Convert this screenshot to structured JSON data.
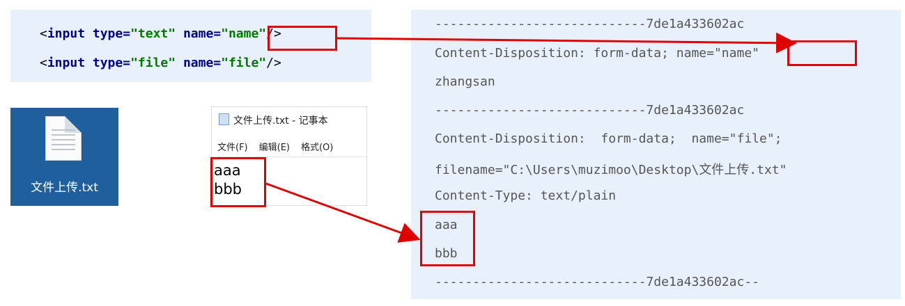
{
  "html_code": {
    "line1": {
      "open": "<",
      "tag": "input",
      "type_attr": "type=",
      "type_val": "\"text\"",
      "name_attr": "name=",
      "name_val": "\"name\"",
      "close": "/>"
    },
    "line2": {
      "open": "<",
      "tag": "input",
      "type_attr": "type=",
      "type_val": "\"file\"",
      "name_attr": "name=",
      "name_val": "\"file\"",
      "close": "/>"
    }
  },
  "desktop_file": {
    "label": "文件上传.txt",
    "icon": "text-file-icon"
  },
  "notepad": {
    "title": "文件上传.txt - 记事本",
    "menu": [
      "文件(F)",
      "编辑(E)",
      "格式(O)"
    ],
    "content": [
      "aaa",
      "bbb"
    ]
  },
  "request_body": [
    "----------------------------7de1a433602ac",
    "Content-Disposition: form-data; name=\"name\"",
    "zhangsan",
    "----------------------------7de1a433602ac",
    "Content-Disposition:  form-data;  name=\"file\";",
    "filename=\"C:\\Users\\muzimoo\\Desktop\\文件上传.txt\"",
    "Content-Type: text/plain",
    "aaa",
    "bbb",
    "----------------------------7de1a433602ac--"
  ],
  "colors": {
    "highlight": "#e00000",
    "panel_bg": "#e8f1fb",
    "tag": "#00008b",
    "value": "#007a00",
    "icon_bg": "#1f5f9e"
  }
}
